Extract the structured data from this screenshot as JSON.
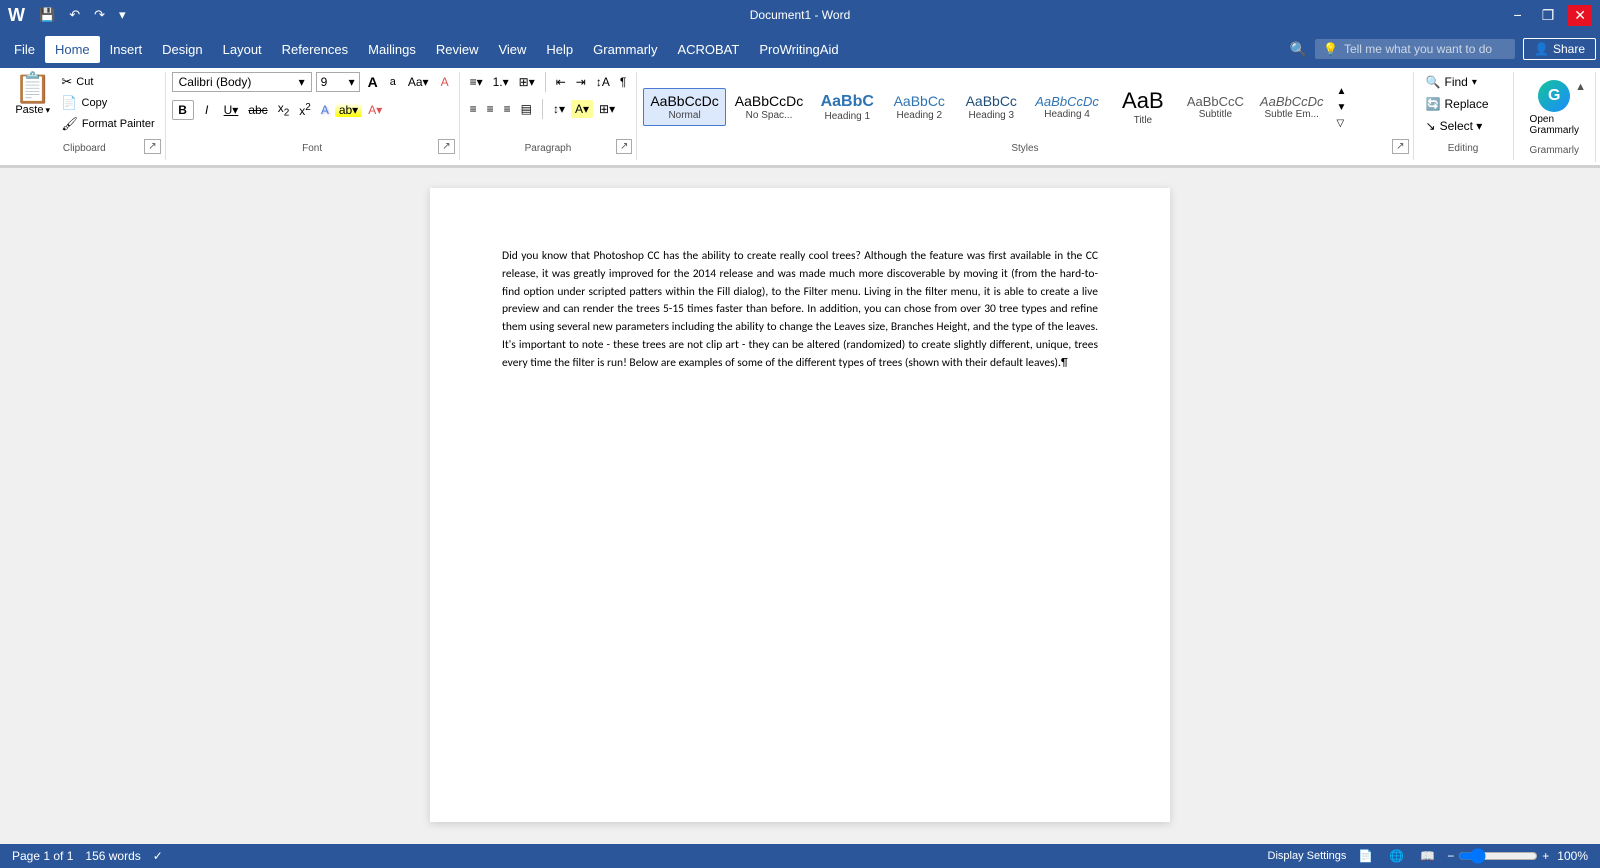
{
  "titlebar": {
    "qat": [
      "save",
      "undo",
      "redo",
      "dropdown"
    ],
    "title": "Document1  -  Word",
    "window_controls": [
      "minimize",
      "restore",
      "close"
    ]
  },
  "menubar": {
    "items": [
      "File",
      "Home",
      "Insert",
      "Design",
      "Layout",
      "References",
      "Mailings",
      "Review",
      "View",
      "Help",
      "Grammarly",
      "ACROBAT",
      "ProWritingAid"
    ],
    "active": "Home",
    "search_placeholder": "Tell me what you want to do",
    "share_label": "Share"
  },
  "ribbon": {
    "groups": {
      "clipboard": {
        "label": "Clipboard",
        "paste_label": "Paste",
        "cut_label": "Cut",
        "copy_label": "Copy",
        "format_painter_label": "Format Painter"
      },
      "font": {
        "label": "Font",
        "font_name": "Calibri (Body)",
        "font_size": "9",
        "bold": "B",
        "italic": "I",
        "underline": "U",
        "strikethrough": "abc",
        "subscript": "x₂",
        "superscript": "x²",
        "clear_format": "A",
        "increase_size": "A",
        "decrease_size": "a"
      },
      "paragraph": {
        "label": "Paragraph"
      },
      "styles": {
        "label": "Styles",
        "items": [
          {
            "label": "Normal",
            "preview": "AaBbCcDc",
            "active": true
          },
          {
            "label": "No Spac...",
            "preview": "AaBbCcDc",
            "active": false
          },
          {
            "label": "Heading 1",
            "preview": "AaBbC",
            "active": false
          },
          {
            "label": "Heading 2",
            "preview": "AaBbCc",
            "active": false
          },
          {
            "label": "Heading 3",
            "preview": "AaBbCc",
            "active": false
          },
          {
            "label": "Heading 4",
            "preview": "AaBbCcDc",
            "active": false
          },
          {
            "label": "Title",
            "preview": "AaB",
            "active": false
          },
          {
            "label": "Subtitle",
            "preview": "AaBbCcC",
            "active": false
          },
          {
            "label": "Subtle Em...",
            "preview": "AaBbCcDc",
            "active": false
          }
        ]
      },
      "editing": {
        "label": "Editing",
        "find_label": "Find",
        "replace_label": "Replace",
        "select_label": "Select ▾"
      },
      "grammarly": {
        "label": "Grammarly",
        "open_label": "Open\nGrammarly"
      }
    }
  },
  "document": {
    "content": "Did you know that Photoshop CC has the ability to create really cool trees? Although the feature was first available in the CC release, it was greatly improved for the 2014 release and was made much more discoverable by moving it (from the hard-to-find option under scripted patters within the Fill dialog), to the Filter menu. Living in the filter menu, it is able to create a live preview and can render the trees 5-15 times faster than before. In addition, you can chose from over 30 tree types and refine them using several new parameters including the ability to change the Leaves size, Branches Height, and the type of the leaves. It's important to note - these trees are not clip art - they can be altered (randomized) to create slightly different, unique, trees every time the filter is run! Below are examples of some of the different types of trees (shown with their default leaves).¶"
  },
  "statusbar": {
    "page_info": "Page 1 of 1",
    "word_count": "156 words",
    "language": "",
    "proofing_icon": "✓",
    "view_print": "📄",
    "view_web": "🌐",
    "view_read": "📖",
    "zoom_level": "100%",
    "display_settings": "Display Settings"
  }
}
